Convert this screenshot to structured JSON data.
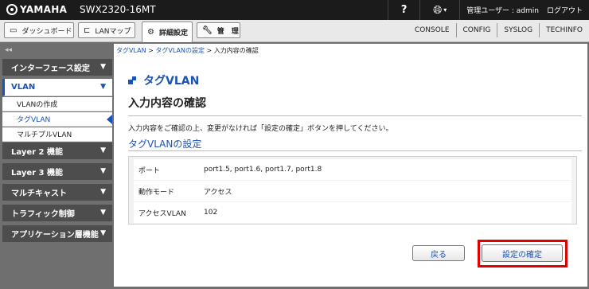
{
  "header": {
    "brand": "YAMAHA",
    "model": "SWX2320-16MT",
    "help_glyph": "?",
    "user_text": "管理ユーザー : admin",
    "logout": "ログアウト"
  },
  "tabs": [
    {
      "label": "ダッシュボード",
      "icon": "dashboard-icon"
    },
    {
      "label": "LANマップ",
      "icon": "lan-map-icon"
    },
    {
      "label": "詳細設定",
      "icon": "gear-icon"
    },
    {
      "label": "管　理",
      "icon": "wrench-icon"
    }
  ],
  "ext_links": [
    "CONSOLE",
    "CONFIG",
    "SYSLOG",
    "TECHINFO"
  ],
  "sidebar": {
    "collapse": "◂◂",
    "menus": [
      {
        "label": "インターフェース設定"
      },
      {
        "label": "VLAN"
      },
      {
        "label": "Layer 2 機能"
      },
      {
        "label": "Layer 3 機能"
      },
      {
        "label": "マルチキャスト"
      },
      {
        "label": "トラフィック制御"
      },
      {
        "label": "アプリケーション層機能"
      }
    ],
    "vlan_items": [
      "VLANの作成",
      "タグVLAN",
      "マルチプルVLAN"
    ]
  },
  "breadcrumb": {
    "item1": "タグVLAN",
    "sep": ">",
    "item2": "タグVLANの設定",
    "item3": "入力内容の確認"
  },
  "main": {
    "page_title": "タグVLAN",
    "confirm_title": "入力内容の確認",
    "instruction": "入力内容をご確認の上、変更がなければ「設定の確定」ボタンを押してください。",
    "section_title": "タグVLANの設定",
    "rows": [
      {
        "key": "ポート",
        "value": "port1.5, port1.6, port1.7, port1.8"
      },
      {
        "key": "動作モード",
        "value": "アクセス"
      },
      {
        "key": "アクセスVLAN",
        "value": "102"
      }
    ],
    "back_label": "戻る",
    "confirm_label": "設定の確定"
  },
  "colors": {
    "accent": "#1a52b5",
    "highlight": "#e00000",
    "topbar": "#1b1b1b",
    "sidebar": "#4d4d4d"
  }
}
